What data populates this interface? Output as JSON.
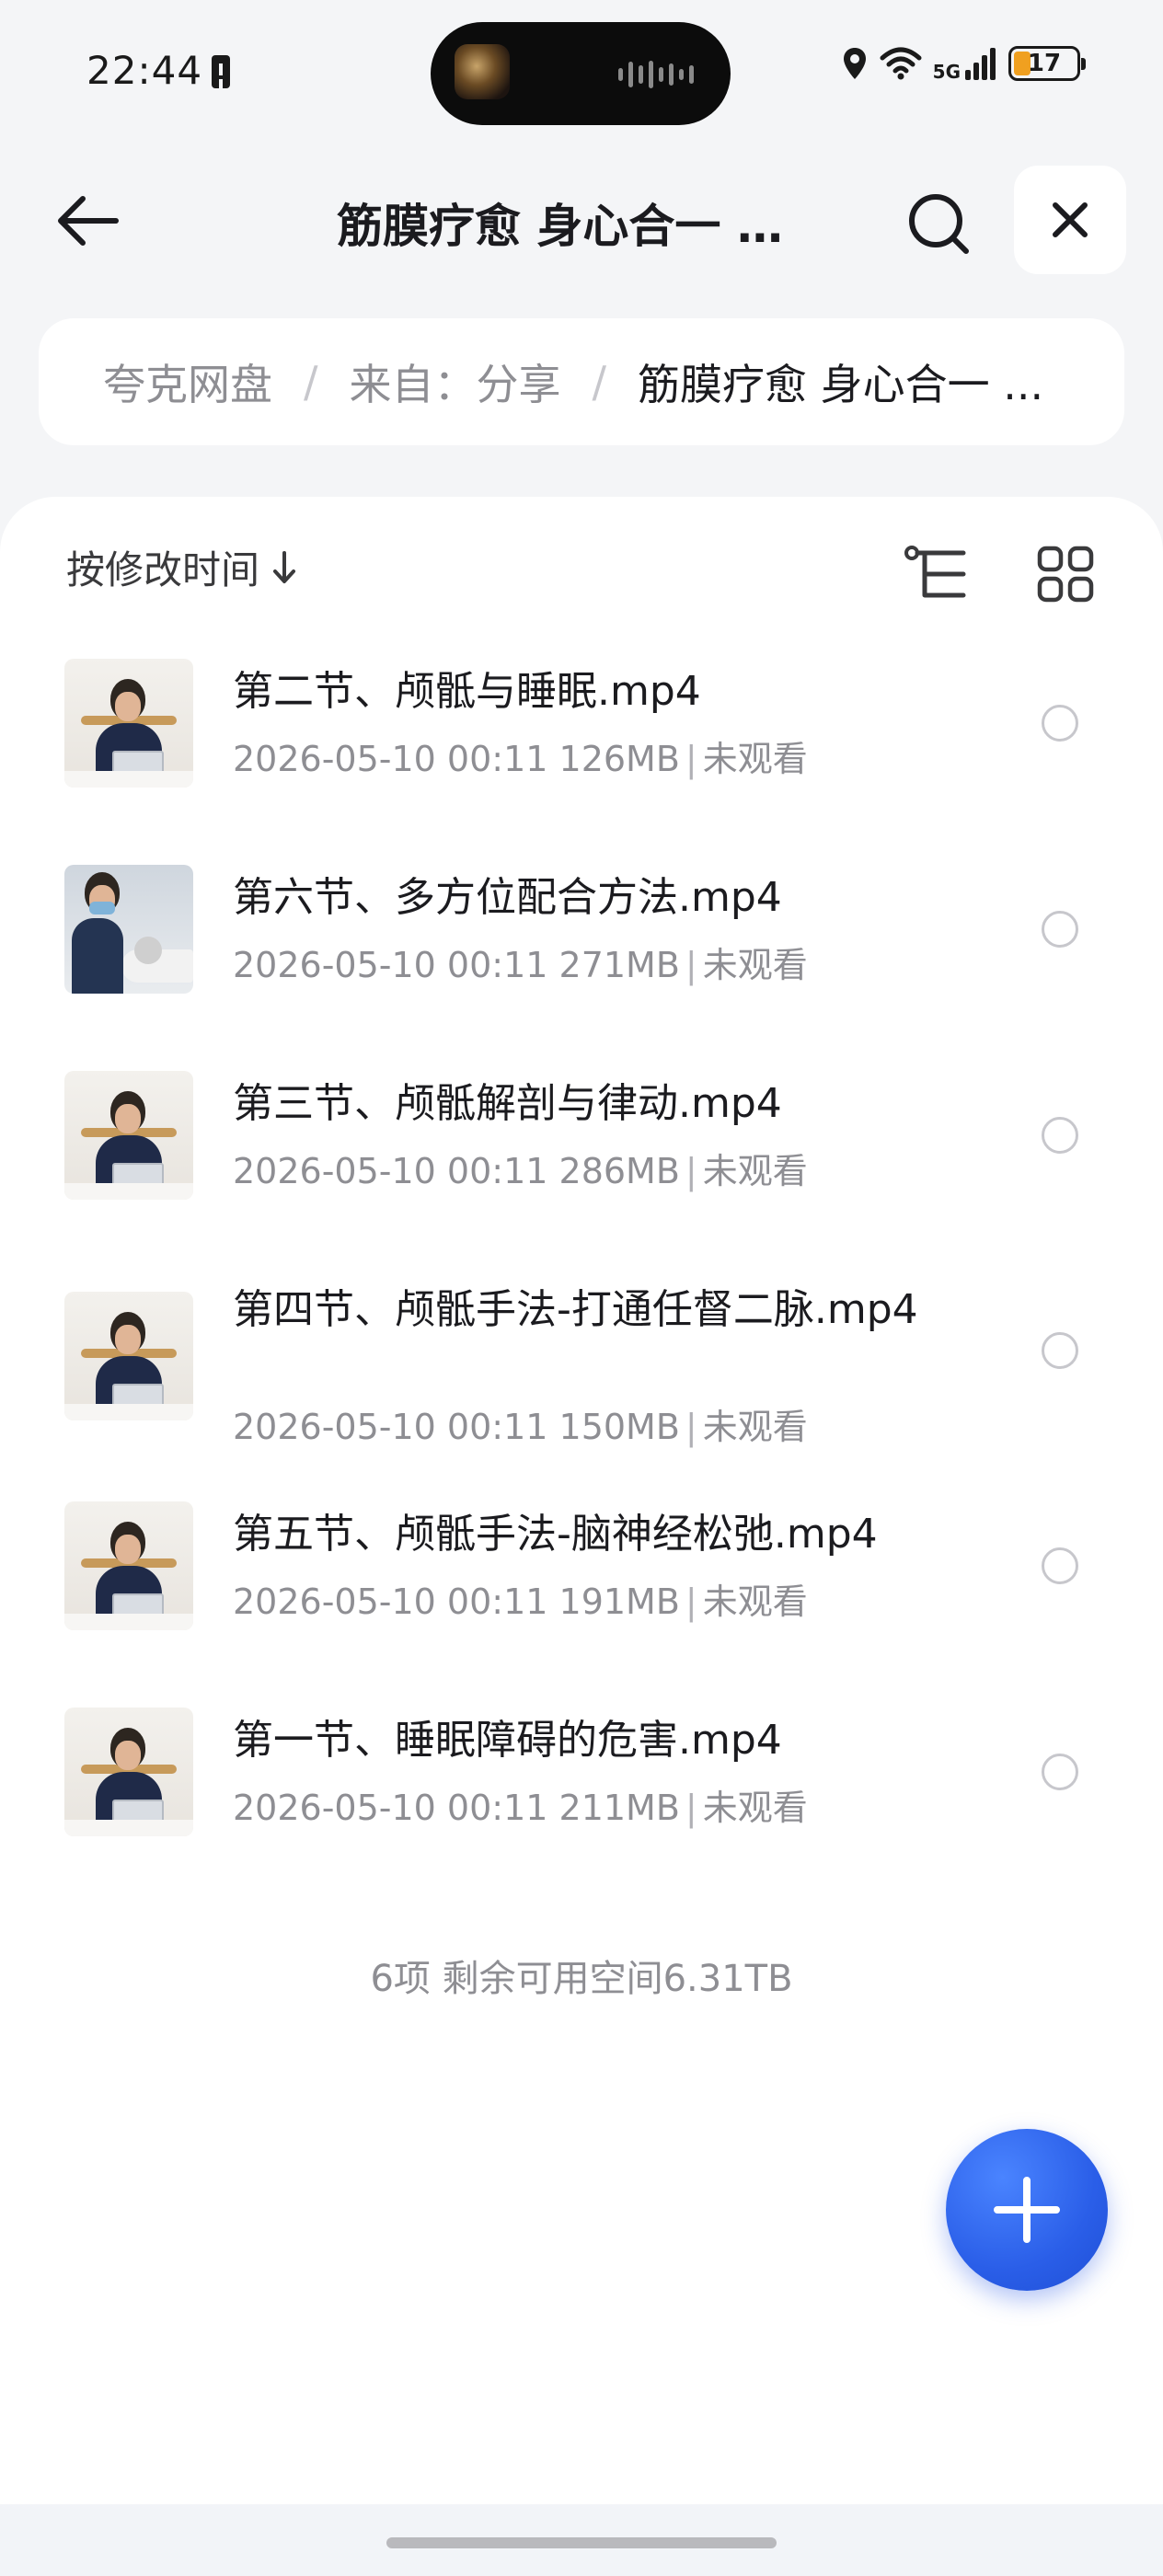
{
  "status_bar": {
    "time": "22:44",
    "network": "5G",
    "battery_level": "17",
    "icons": [
      "battery-alert-icon",
      "location-icon",
      "wifi-icon",
      "signal-icon",
      "battery-icon"
    ]
  },
  "nav": {
    "title": "筋膜疗愈 身心合一  …",
    "back_icon": "arrow-left-icon",
    "search_icon": "search-icon",
    "close_icon": "close-icon"
  },
  "breadcrumb": {
    "items": [
      "夸克网盘",
      "来自：分享",
      "筋膜疗愈 身心合一  ..."
    ],
    "separator": "/"
  },
  "toolbar": {
    "sort_label": "按修改时间",
    "sort_icon": "arrow-down-icon",
    "tree_view_icon": "tree-view-icon",
    "grid_view_icon": "grid-view-icon"
  },
  "files": [
    {
      "name": "第二节、颅骶与睡眠.mp4",
      "date": "2026-05-10 00:11",
      "size": "126MB",
      "status": "未观看"
    },
    {
      "name": "第六节、多方位配合方法.mp4",
      "date": "2026-05-10 00:11",
      "size": "271MB",
      "status": "未观看"
    },
    {
      "name": "第三节、颅骶解剖与律动.mp4",
      "date": "2026-05-10 00:11",
      "size": "286MB",
      "status": "未观看"
    },
    {
      "name": "第四节、颅骶手法-打通任督二脉.mp4",
      "date": "2026-05-10 00:11",
      "size": "150MB",
      "status": "未观看"
    },
    {
      "name": "第五节、颅骶手法-脑神经松弛.mp4",
      "date": "2026-05-10 00:11",
      "size": "191MB",
      "status": "未观看"
    },
    {
      "name": "第一节、睡眠障碍的危害.mp4",
      "date": "2026-05-10 00:11",
      "size": "211MB",
      "status": "未观看"
    }
  ],
  "footer": {
    "summary": "6项 剩余可用空间6.31TB"
  },
  "fab": {
    "icon": "plus-icon"
  },
  "colors": {
    "accent": "#2a5ee8",
    "battery_low": "#f0a020",
    "background": "#f4f5f7",
    "card": "#ffffff",
    "secondary_text": "#8e8e93"
  }
}
